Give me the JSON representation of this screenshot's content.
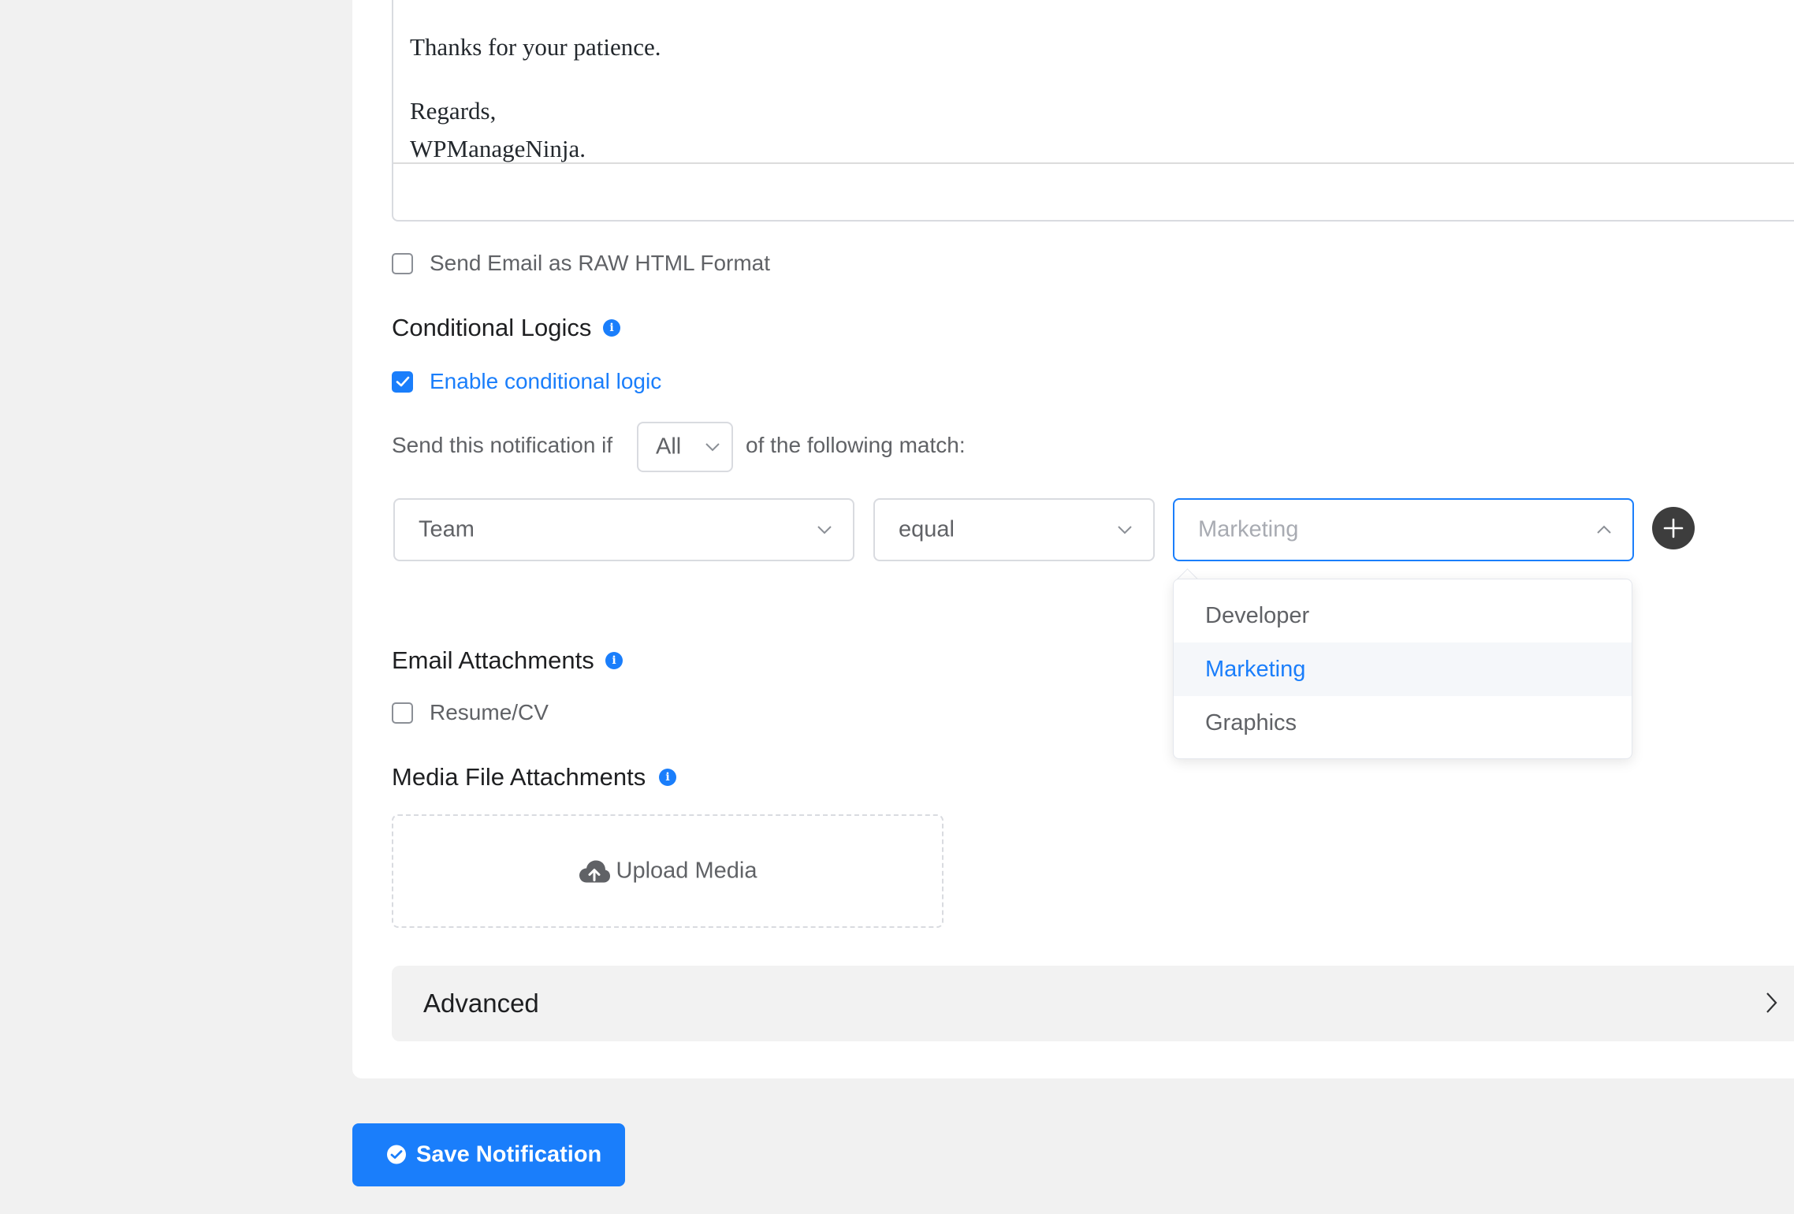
{
  "editor": {
    "line1": "Thanks for your patience.",
    "line2": "Regards,",
    "line3": "WPManageNinja."
  },
  "raw_html_checkbox": {
    "label": "Send Email as RAW HTML Format",
    "checked": false
  },
  "conditional_logics": {
    "title": "Conditional Logics",
    "enable_label": "Enable conditional logic",
    "enabled": true,
    "rule_prefix": "Send this notification if",
    "match_type": "All",
    "rule_suffix": "of the following match:",
    "field": "Team",
    "operator": "equal",
    "value_placeholder": "Marketing",
    "options": [
      "Developer",
      "Marketing",
      "Graphics"
    ],
    "selected_option": "Marketing"
  },
  "email_attachments": {
    "title": "Email Attachments",
    "item_label": "Resume/CV",
    "checked": false
  },
  "media_attachments": {
    "title": "Media File Attachments",
    "upload_label": "Upload Media"
  },
  "advanced": {
    "label": "Advanced"
  },
  "save_button": {
    "label": "Save Notification"
  },
  "colors": {
    "accent": "#1a7efb",
    "text": "#606266",
    "heading": "#1e1f21"
  }
}
